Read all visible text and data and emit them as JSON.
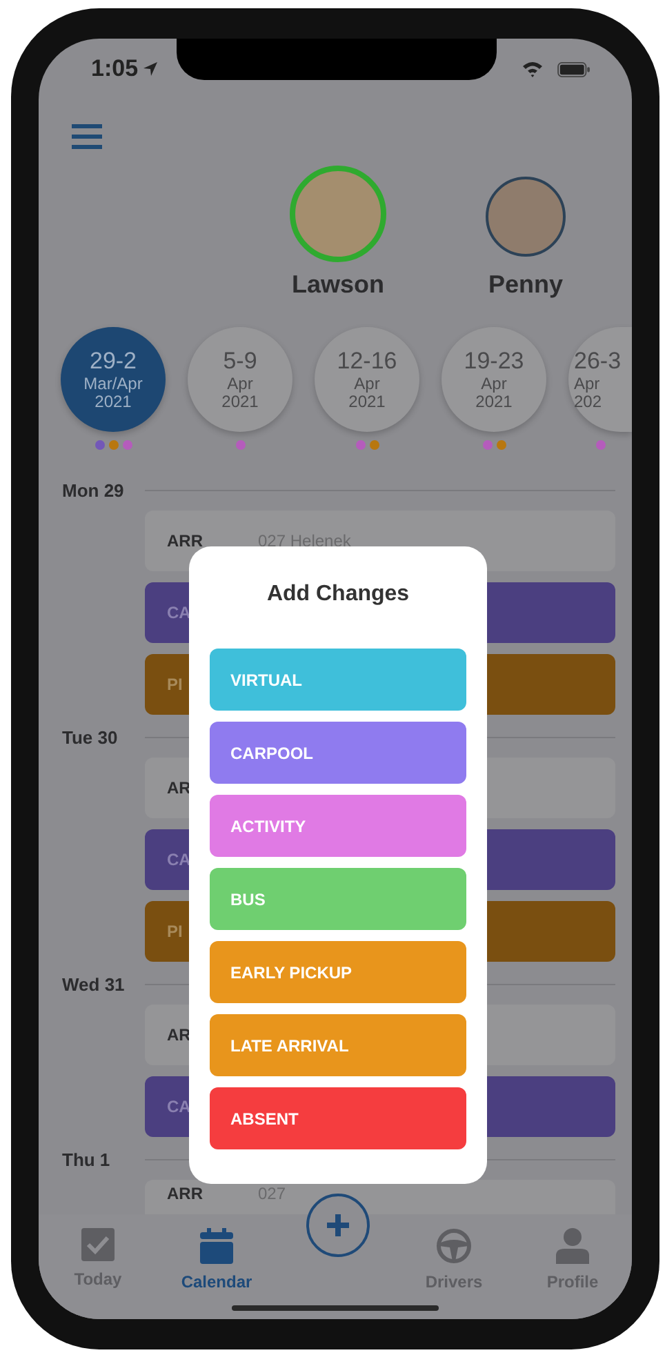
{
  "status_bar": {
    "time": "1:05"
  },
  "children": [
    {
      "name": "Lawson",
      "selected": true
    },
    {
      "name": "Penny",
      "selected": false
    }
  ],
  "weeks": [
    {
      "range": "29-2",
      "month": "Mar/Apr",
      "year": "2021",
      "selected": true,
      "events": [
        {
          "color": "#7358b8"
        },
        {
          "color": "#b8770f"
        },
        {
          "color": "#b55cbc"
        }
      ]
    },
    {
      "range": "5-9",
      "month": "Apr",
      "year": "2021",
      "selected": false,
      "events": [
        {
          "color": "#b55cbc"
        }
      ]
    },
    {
      "range": "12-16",
      "month": "Apr",
      "year": "2021",
      "selected": false,
      "events": [
        {
          "color": "#b55cbc"
        },
        {
          "color": "#b8770f"
        }
      ]
    },
    {
      "range": "19-23",
      "month": "Apr",
      "year": "2021",
      "selected": false,
      "events": [
        {
          "color": "#b55cbc"
        },
        {
          "color": "#b8770f"
        }
      ]
    },
    {
      "range": "26-3",
      "month": "Apr",
      "year": "202",
      "selected": false,
      "events": [
        {
          "color": "#b55cbc"
        }
      ]
    }
  ],
  "days": [
    {
      "label": "Mon 29",
      "entries": [
        {
          "kind": "arrival",
          "code": "ARR",
          "detail": "027 Helenek"
        },
        {
          "kind": "carpool",
          "code": "CA"
        },
        {
          "kind": "pickup",
          "code": "PI"
        }
      ]
    },
    {
      "label": "Tue 30",
      "entries": [
        {
          "kind": "arrival",
          "code": "AR"
        },
        {
          "kind": "carpool",
          "code": "CA"
        },
        {
          "kind": "pickup",
          "code": "PI"
        }
      ]
    },
    {
      "label": "Wed 31",
      "entries": [
        {
          "kind": "arrival",
          "code": "AR"
        },
        {
          "kind": "carpool",
          "code": "CA"
        }
      ]
    },
    {
      "label": "Thu 1",
      "entries": [
        {
          "kind": "arrival",
          "code": "ARR",
          "detail": "027"
        }
      ]
    }
  ],
  "modal": {
    "title": "Add Changes",
    "options": [
      {
        "label": "VIRTUAL",
        "color": "#3fbfda"
      },
      {
        "label": "CARPOOL",
        "color": "#8f7bef"
      },
      {
        "label": "ACTIVITY",
        "color": "#e07ae4"
      },
      {
        "label": "BUS",
        "color": "#6fcf70"
      },
      {
        "label": "EARLY PICKUP",
        "color": "#e8951c"
      },
      {
        "label": "LATE ARRIVAL",
        "color": "#e8951c"
      },
      {
        "label": "ABSENT",
        "color": "#f53d3f"
      }
    ]
  },
  "tab_bar": {
    "tabs": [
      {
        "kind": "today",
        "label": "Today",
        "selected": false
      },
      {
        "kind": "calendar",
        "label": "Calendar",
        "selected": true
      },
      {
        "kind": "add"
      },
      {
        "kind": "drivers",
        "label": "Drivers",
        "selected": false
      },
      {
        "kind": "profile",
        "label": "Profile",
        "selected": false
      }
    ]
  }
}
